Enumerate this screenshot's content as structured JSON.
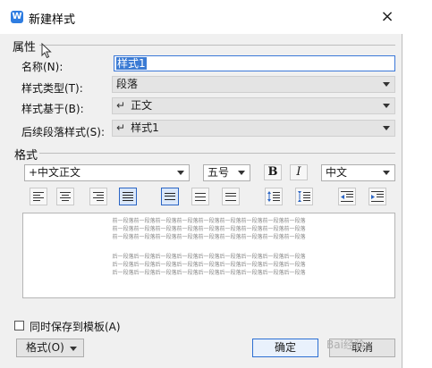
{
  "dialog": {
    "title": "新建样式",
    "close_glyph": "×"
  },
  "properties": {
    "header": "属性",
    "name_label": "名称(N):",
    "name_value": "样式1",
    "type_label": "样式类型(T):",
    "type_value": "段落",
    "based_on_label": "样式基于(B):",
    "based_on_value": "正文",
    "next_label": "后续段落样式(S):",
    "next_value": "样式1",
    "return_glyph": "↵"
  },
  "format": {
    "header": "格式",
    "font_value": "+中文正文",
    "size_value": "五号",
    "bold_label": "B",
    "italic_label": "I",
    "script_value": "中文"
  },
  "preview": {
    "prev_paragraph_lines": [
      "前一段落前一段落前一段落前一段落前一段落前一段落前一段落前一段落前一段落",
      "前一段落前一段落前一段落前一段落前一段落前一段落前一段落前一段落前一段落",
      "前一段落前一段落前一段落前一段落前一段落前一段落前一段落前一段落前一段落"
    ],
    "next_paragraph_lines": [
      "后一段落后一段落后一段落后一段落后一段落后一段落后一段落后一段落后一段落",
      "后一段落后一段落后一段落后一段落后一段落后一段落后一段落后一段落后一段落",
      "后一段落后一段落后一段落后一段落后一段落后一段落后一段落后一段落后一段落"
    ]
  },
  "footer": {
    "add_to_template_label": "同时保存到模板(A)",
    "format_menu_label": "格式(O)",
    "ok_label": "确定",
    "cancel_label": "取消"
  },
  "watermark": "Bai经验"
}
